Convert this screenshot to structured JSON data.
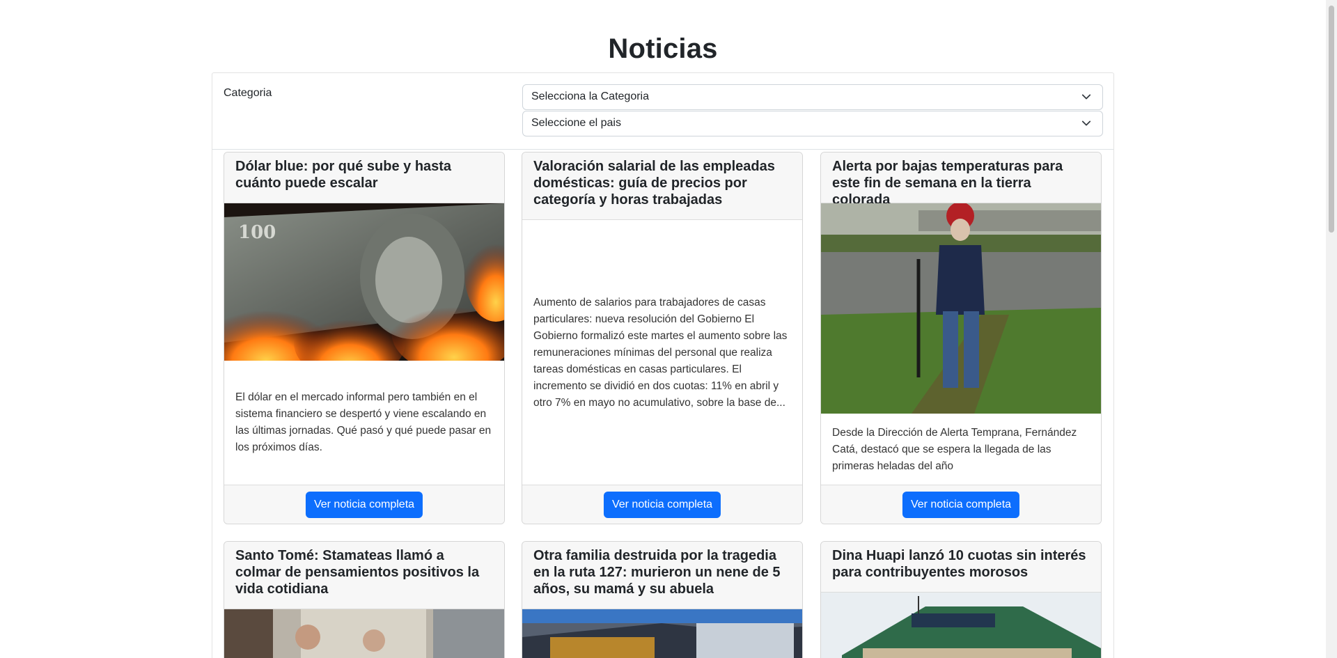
{
  "page": {
    "title": "Noticias"
  },
  "filters": {
    "label": "Categoria",
    "category_placeholder": "Selecciona la Categoria",
    "country_placeholder": "Seleccione el pais"
  },
  "cards": [
    {
      "title": "Dólar blue: por qué sube y hasta cuánto puede escalar",
      "text": "El dólar en el mercado informal pero también en el sistema financiero se despertó y viene escalando en las últimas jornadas. Qué pasó y qué puede pasar en los próximos días.",
      "button": "Ver noticia completa"
    },
    {
      "title": "Valoración salarial de las empleadas domésticas: guía de precios por categoría y horas trabajadas",
      "text": "Aumento de salarios para trabajadores de casas particulares: nueva resolución del Gobierno El Gobierno formalizó este martes el aumento sobre las remuneraciones mínimas del personal que realiza tareas domésticas en casas particulares. El incremento se dividió en dos cuotas: 11% en abril y otro 7% en mayo no acumulativo, sobre la base de...",
      "button": "Ver noticia completa"
    },
    {
      "title": "Alerta por bajas temperaturas para este fin de semana en la tierra colorada",
      "text": "Desde la Dirección de Alerta Temprana, Fernández Catá, destacó que se espera la llegada de las primeras heladas del año",
      "button": "Ver noticia completa"
    },
    {
      "title": "Santo Tomé: Stamateas llamó a colmar de pensamientos positivos la vida cotidiana"
    },
    {
      "title": "Otra familia destruida por la tragedia en la ruta 127: murieron un nene de 5 años, su mamá y su abuela"
    },
    {
      "title": "Dina Huapi lanzó 10 cuotas sin interés para contribuyentes morosos"
    }
  ]
}
